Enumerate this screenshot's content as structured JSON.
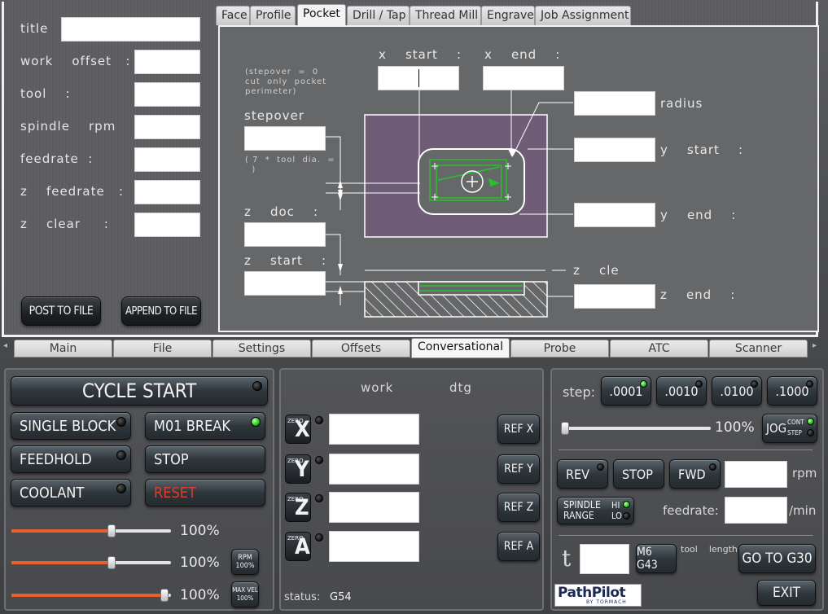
{
  "fields": {
    "title": "title   :",
    "work_offset": "work    offset   :",
    "tool": "tool    :",
    "spindle_rpm": "spindle    rpm",
    "feedrate": "feedrate  :",
    "z_feedrate": "z    feedrate   :",
    "z_clear": "z    clear     :"
  },
  "buttons": {
    "post_to_file": "POST TO FILE",
    "append_to_file": "APPEND TO FILE"
  },
  "sub_tabs": [
    "Face",
    "Profile",
    "Pocket",
    "Drill / Tap",
    "Thread Mill",
    "Engrave",
    "Job Assignment"
  ],
  "pocket": {
    "x_start": "x    start    :",
    "x_end": "x    end    :",
    "stepover_note": "(stepover  =  0\ncut  only  pocket\nperimeter)",
    "stepover": "stepover",
    "stepover_dia_note": "( 7  *  tool  dia.  =\n  )",
    "z_doc": "z    doc    :",
    "z_start": "z    start    :",
    "radius": "radius",
    "y_start": "y    start    :",
    "y_end": "y    end    :",
    "z_clear": "z    cle",
    "z_end": "z    end    :"
  },
  "notebook_tabs": [
    "Main",
    "File",
    "Settings",
    "Offsets",
    "Conversational",
    "Probe",
    "ATC",
    "Scanner"
  ],
  "left_panel": {
    "cycle_start": "CYCLE START",
    "single_block": "SINGLE BLOCK",
    "m01_break": "M01 BREAK",
    "feedhold": "FEEDHOLD",
    "stop": "STOP",
    "coolant": "COOLANT",
    "reset": "RESET",
    "sliders": [
      {
        "value": 0.63,
        "label": "100%"
      },
      {
        "value": 0.63,
        "label": "100%"
      },
      {
        "value": 0.96,
        "label": "100%"
      }
    ],
    "rpm_btn": [
      "RPM",
      "100%"
    ],
    "maxvel_btn": [
      "MAX VEL",
      "100%"
    ]
  },
  "dro_panel": {
    "work": "work",
    "dtg": "dtg",
    "axes": [
      "X",
      "Y",
      "Z",
      "A"
    ],
    "zero": "ZERO",
    "ref": [
      "REF X",
      "REF Y",
      "REF Z",
      "REF A"
    ],
    "status_label": "status:",
    "status_value": "G54"
  },
  "right_panel": {
    "step_label": "step:",
    "steps": [
      ".0001",
      ".0010",
      ".0100",
      ".1000"
    ],
    "jog_pct": "100%",
    "jog": "JOG",
    "cont": "CONT",
    "step": "STEP",
    "rev": "REV",
    "stop": "STOP",
    "fwd": "FWD",
    "rpm": "rpm",
    "spindle": "SPINDLE",
    "range": "RANGE",
    "hi": "HI",
    "lo": "LO",
    "feedrate": "feedrate:",
    "per_min": "/min",
    "t": "t",
    "m6g43": "M6 G43",
    "tool_length": "tool    length",
    "go_to_g30": "GO TO G30",
    "exit": "EXIT",
    "logo_main": "PathPilot",
    "logo_sub": "BY TORMACH"
  },
  "colors": {
    "accent_orange": "#e8602a",
    "led_green": "#22c21a",
    "reset_red": "#e23b2b",
    "diagram_purple": "#6f5d78",
    "toolpath_green": "#26c22a"
  }
}
